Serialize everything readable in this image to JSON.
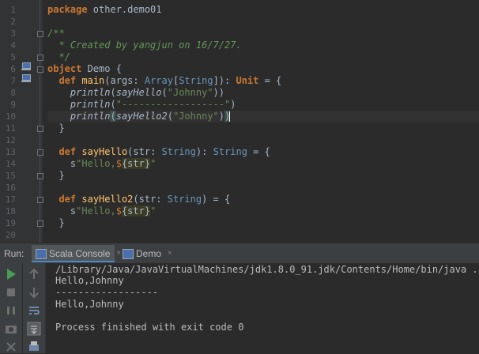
{
  "editor": {
    "line_numbers": [
      "1",
      "2",
      "3",
      "4",
      "5",
      "6",
      "7",
      "8",
      "9",
      "10",
      "11",
      "12",
      "13",
      "14",
      "15",
      "16",
      "17",
      "18",
      "19",
      "20"
    ],
    "lines": {
      "l1_kw": "package",
      "l1_rest": " other.demo01",
      "l3": "/**",
      "l4_a": "  * Created by ",
      "l4_b": "yangjun",
      "l4_c": " on 16/7/27.",
      "l5": "  */",
      "l6_kw": "object",
      "l6_rest": " Demo {",
      "l7_indent": "  ",
      "l7_kw": "def",
      "l7_fn": " main",
      "l7_a": "(args: ",
      "l7_ty1": "Array",
      "l7_b": "[",
      "l7_ty2": "String",
      "l7_c": "]): ",
      "l7_ty3": "Unit",
      "l7_d": " = {",
      "l8_a": "    ",
      "l8_fn": "println",
      "l8_b": "(",
      "l8_call": "sayHello",
      "l8_c": "(",
      "l8_str": "\"Johnny\"",
      "l8_d": "))",
      "l9_a": "    ",
      "l9_fn": "println",
      "l9_b": "(",
      "l9_str": "\"------------------\"",
      "l9_c": ")",
      "l10_a": "    ",
      "l10_fn": "println",
      "l10_b": "(",
      "l10_call": "sayHello2",
      "l10_c": "(",
      "l10_str": "\"Johnny\"",
      "l10_d": ")",
      "l10_e": ")",
      "l11": "  }",
      "l13_indent": "  ",
      "l13_kw": "def",
      "l13_fn": " sayHello",
      "l13_a": "(str: ",
      "l13_ty1": "String",
      "l13_b": "): ",
      "l13_ty2": "String",
      "l13_c": " = {",
      "l14_a": "    s",
      "l14_str": "\"Hello,",
      "l14_dollar": "$",
      "l14_interp": "{str}",
      "l14_end": "\"",
      "l15": "  }",
      "l17_indent": "  ",
      "l17_kw": "def",
      "l17_fn": " sayHello2",
      "l17_a": "(str: ",
      "l17_ty1": "String",
      "l17_b": ") = {",
      "l18_a": "    s",
      "l18_str": "\"Hello,",
      "l18_dollar": "$",
      "l18_interp": "{str}",
      "l18_end": "\"",
      "l19": "  }"
    }
  },
  "runbar": {
    "label": "Run:",
    "tabs": [
      {
        "label": "Scala Console",
        "close": "×"
      },
      {
        "label": "Demo",
        "close": "×"
      }
    ]
  },
  "console": {
    "lines": [
      "/Library/Java/JavaVirtualMachines/jdk1.8.0_91.jdk/Contents/Home/bin/java ...",
      "Hello,Johnny",
      "------------------",
      "Hello,Johnny",
      "",
      "Process finished with exit code 0"
    ]
  },
  "colors": {
    "editor_bg": "#2b2b2b",
    "gutter_bg": "#313335",
    "keyword": "#cc7832",
    "function": "#ffc66d",
    "string": "#6a8759",
    "comment": "#629755",
    "type": "#6897bb",
    "run_green": "#499c54"
  },
  "icons": {
    "gutter_run": "run-gutter-icon",
    "rerun": "rerun-icon",
    "stop": "stop-icon",
    "up": "up-arrow-icon",
    "down": "down-arrow-icon"
  }
}
